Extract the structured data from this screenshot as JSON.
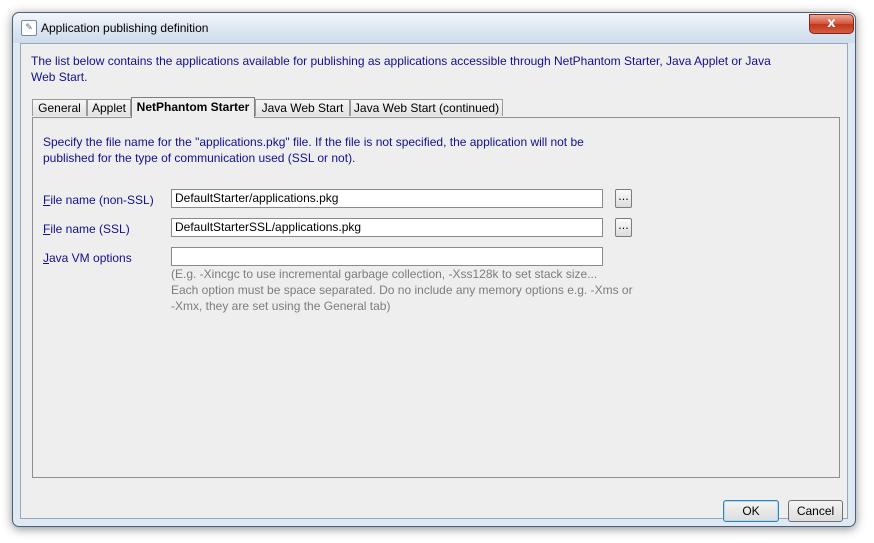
{
  "window": {
    "title": "Application publishing definition",
    "close_glyph": "x",
    "app_icon": "document-icon"
  },
  "intro_text": "The list below contains the applications available for publishing as applications accessible through NetPhantom Starter, Java Applet or Java Web Start.",
  "tabs": [
    {
      "label": "General",
      "active": false
    },
    {
      "label": "Applet",
      "active": false
    },
    {
      "label": "NetPhantom Starter",
      "active": true
    },
    {
      "label": "Java Web Start",
      "active": false
    },
    {
      "label": "Java Web Start (continued)",
      "active": false
    }
  ],
  "panel": {
    "description": "Specify the file name for the \"applications.pkg\" file. If the file is not specified, the application will not be published for the type of communication used (SSL or not).",
    "fields": [
      {
        "mnemonic": "F",
        "label_rest": "ile name (non-SSL)",
        "value": "DefaultStarter/applications.pkg",
        "has_browse": true
      },
      {
        "mnemonic": "F",
        "label_rest": "ile name (SSL)",
        "value": "DefaultStarterSSL/applications.pkg",
        "has_browse": true
      },
      {
        "mnemonic": "J",
        "label_rest": "ava VM options",
        "value": "",
        "has_browse": false
      }
    ],
    "browse_label": "...",
    "hint_lines": [
      "(E.g. -Xincgc to use incremental garbage collection, -Xss128k to set stack size...",
      "Each option must be space separated. Do no include any memory options e.g. -Xms or",
      "-Xmx, they are set using the General tab)"
    ]
  },
  "buttons": {
    "ok": "OK",
    "cancel": "Cancel"
  },
  "colors": {
    "label_blue": "#101090",
    "hint_gray": "#7d7d7d",
    "close_red": "#c1361c"
  }
}
